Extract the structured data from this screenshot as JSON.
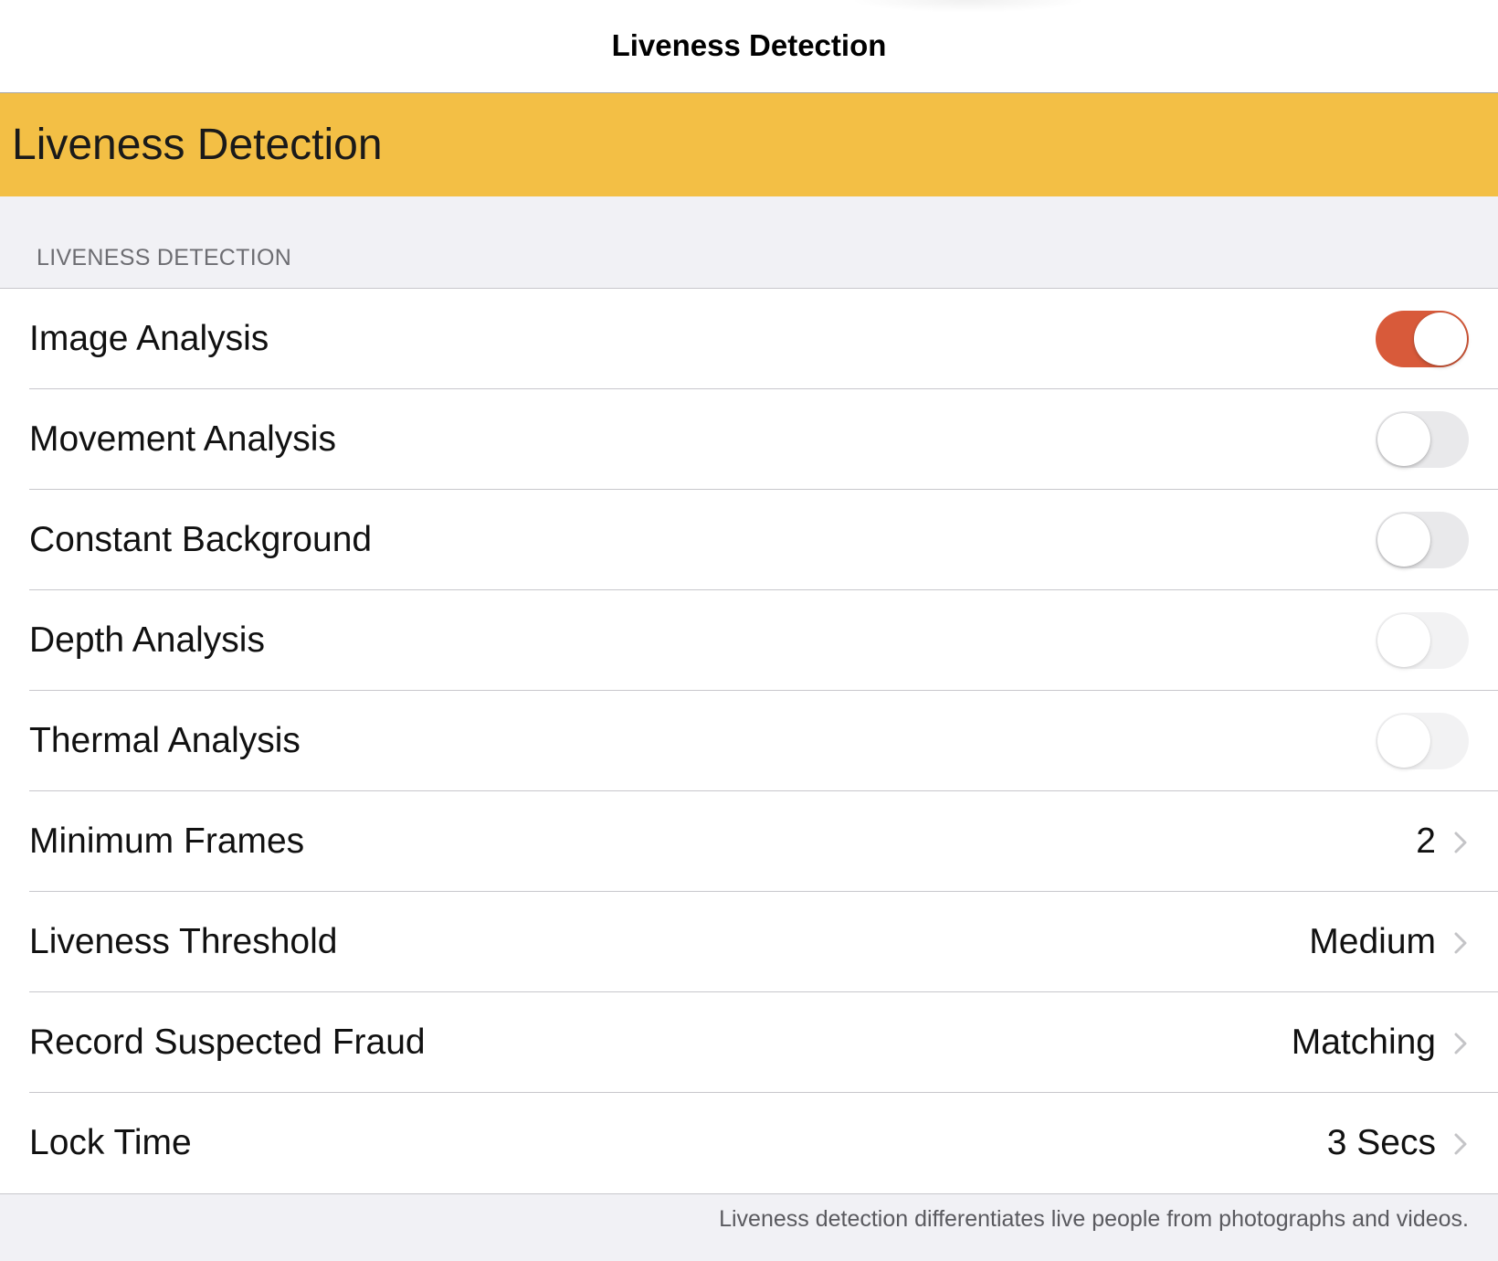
{
  "nav": {
    "title": "Liveness Detection"
  },
  "banner": {
    "title": "Liveness Detection"
  },
  "section": {
    "header": "LIVENESS DETECTION",
    "footer": "Liveness detection differentiates live people from photographs and videos."
  },
  "toggles": [
    {
      "label": "Image Analysis",
      "on": true,
      "enabled": true
    },
    {
      "label": "Movement Analysis",
      "on": false,
      "enabled": true
    },
    {
      "label": "Constant Background",
      "on": false,
      "enabled": true
    },
    {
      "label": "Depth Analysis",
      "on": false,
      "enabled": false
    },
    {
      "label": "Thermal Analysis",
      "on": false,
      "enabled": false
    }
  ],
  "selections": [
    {
      "label": "Minimum Frames",
      "value": "2"
    },
    {
      "label": "Liveness Threshold",
      "value": "Medium"
    },
    {
      "label": "Record Suspected Fraud",
      "value": "Matching"
    },
    {
      "label": "Lock Time",
      "value": "3 Secs"
    }
  ],
  "colors": {
    "accent": "#f3bf45",
    "toggle_on": "#d85a3a",
    "toggle_off": "#e9e9eb",
    "background": "#f1f1f5"
  },
  "icons": {
    "disclosure": "chevron-right-icon"
  }
}
